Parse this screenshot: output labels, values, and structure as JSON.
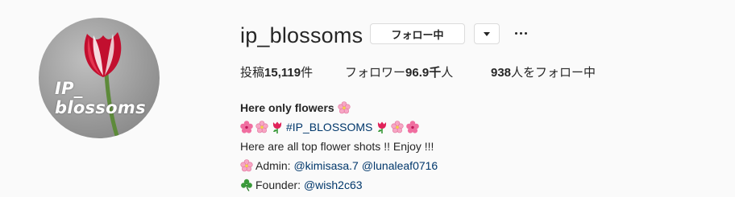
{
  "profile": {
    "username": "ip_blossoms",
    "avatar_text_line1": "IP_",
    "avatar_text_line2": "blossoms"
  },
  "actions": {
    "follow_label": "フォロー中",
    "dropdown_icon": "chevron-down-icon",
    "more_icon": "more-options-icon"
  },
  "stats": {
    "posts_prefix": "投稿",
    "posts_count": "15,119",
    "posts_suffix": "件",
    "followers_prefix": "フォロワー",
    "followers_count": "96.9千",
    "followers_suffix": "人",
    "following_count": "938",
    "following_suffix": "人をフォロー中"
  },
  "bio": {
    "name": "Here only flowers",
    "hashtag": "#IP_BLOSSOMS",
    "tagline": "Here are all top flower shots !! Enjoy !!!",
    "admin_label": "Admin: ",
    "admin_1": "@kimisasa.7",
    "admin_2": "@lunaleaf0716",
    "founder_label": "Founder: ",
    "founder": "@wish2c63"
  },
  "colors": {
    "background": "#fafafa",
    "text": "#262626",
    "link": "#00376b",
    "border": "#dbdbdb",
    "flower_pink": "#f06ea0",
    "tulip_red": "#d0103a",
    "clover_green": "#3a9a3a"
  },
  "icons": {
    "hibiscus": "hibiscus-icon",
    "cherry_blossom": "cherry-blossom-icon",
    "tulip": "tulip-icon",
    "shamrock": "shamrock-icon"
  }
}
